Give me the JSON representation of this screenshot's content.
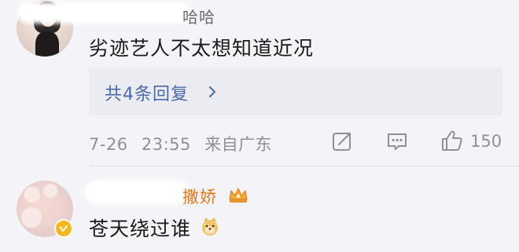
{
  "comment1": {
    "username_visible": "哈哈",
    "text": "劣迹艺人不太想知道近况",
    "replies_label": "共4条回复",
    "date": "7-26",
    "time": "23:55",
    "source": "来自广东",
    "like_count": "150"
  },
  "comment2": {
    "username_visible": "撒娇",
    "text": "苍天绕过谁"
  },
  "colors": {
    "background": "#f4f4f8",
    "link_blue": "#4b6aa8",
    "meta_gray": "#8f8f98",
    "vip_orange": "#e07a22",
    "verified_gold": "#f5b81f"
  },
  "icons": [
    "chevron-right-icon",
    "share-icon",
    "comment-icon",
    "like-icon",
    "verified-icon",
    "crown-badge-icon",
    "dog-emoji-icon"
  ]
}
